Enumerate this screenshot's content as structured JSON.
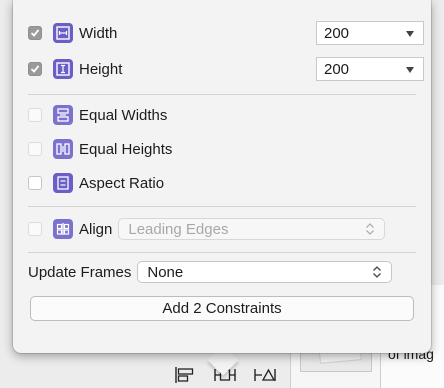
{
  "background": {
    "caption": "of imag"
  },
  "constraints": {
    "width": {
      "label": "Width",
      "checked": true,
      "value": "200"
    },
    "height": {
      "label": "Height",
      "checked": true,
      "value": "200"
    },
    "equal_widths": {
      "label": "Equal Widths",
      "checked": false
    },
    "equal_heights": {
      "label": "Equal Heights",
      "checked": false
    },
    "aspect_ratio": {
      "label": "Aspect Ratio",
      "checked": false
    }
  },
  "align": {
    "label": "Align",
    "value": "Leading Edges",
    "enabled": false
  },
  "update_frames": {
    "label": "Update Frames",
    "value": "None"
  },
  "add_button": {
    "label": "Add 2 Constraints"
  },
  "colors": {
    "icon_accent": "#6a5fc7",
    "popover_bg": "#f3f3f3"
  },
  "icons": [
    "width-constraint-icon",
    "height-constraint-icon",
    "equal-widths-icon",
    "equal-heights-icon",
    "aspect-ratio-icon",
    "align-icon",
    "align-toolbar-icon",
    "pin-toolbar-icon",
    "resolve-toolbar-icon"
  ]
}
